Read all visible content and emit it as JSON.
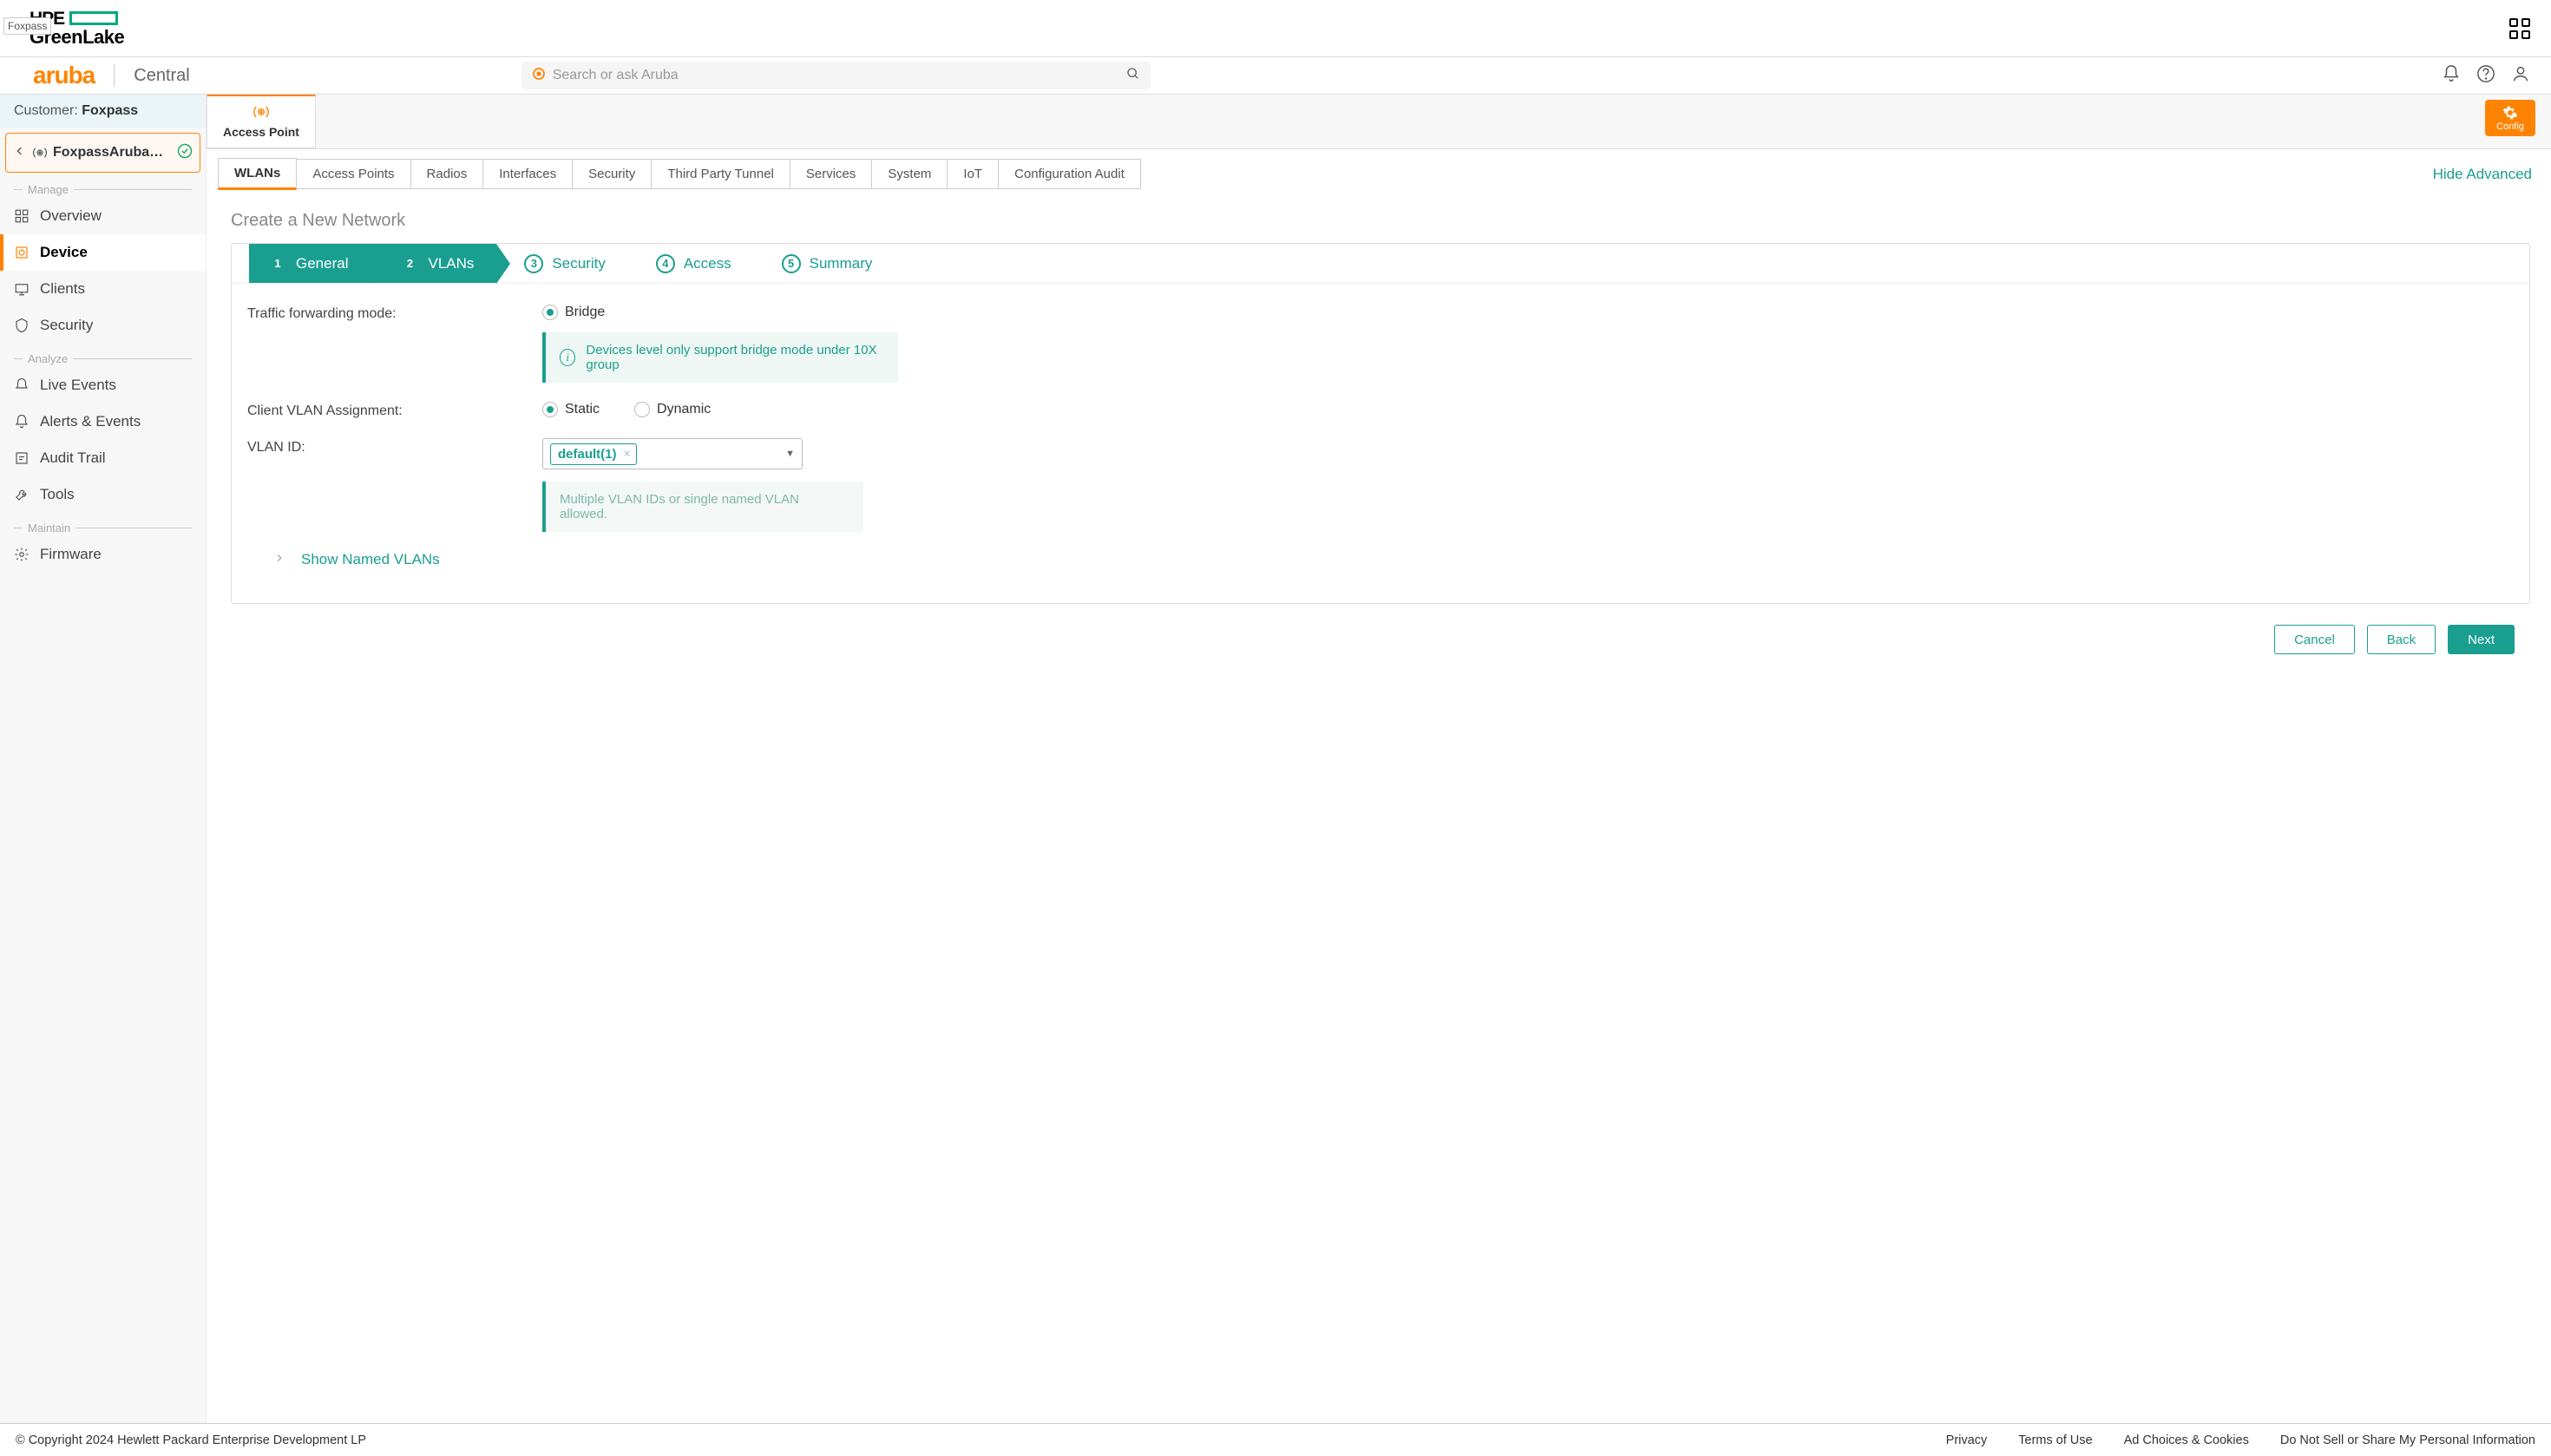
{
  "top": {
    "tag": "Foxpass",
    "hpe": "HPE",
    "greenlake": "GreenLake"
  },
  "aruba": {
    "brand": "aruba",
    "product": "Central",
    "search_placeholder": "Search or ask Aruba"
  },
  "customer": {
    "label": "Customer: ",
    "name": "Foxpass"
  },
  "crumb": {
    "device": "FoxpassArubaAP…"
  },
  "side": {
    "groups": {
      "manage": "Manage",
      "analyze": "Analyze",
      "maintain": "Maintain"
    },
    "items": {
      "overview": "Overview",
      "device": "Device",
      "clients": "Clients",
      "security": "Security",
      "live_events": "Live Events",
      "alerts_events": "Alerts & Events",
      "audit_trail": "Audit Trail",
      "tools": "Tools",
      "firmware": "Firmware"
    }
  },
  "contextTab": {
    "title": "Access Point",
    "config": "Config"
  },
  "tabs": [
    "WLANs",
    "Access Points",
    "Radios",
    "Interfaces",
    "Security",
    "Third Party Tunnel",
    "Services",
    "System",
    "IoT",
    "Configuration Audit"
  ],
  "hideAdvanced": "Hide Advanced",
  "page": {
    "title": "Create a New Network"
  },
  "steps": [
    "General",
    "VLANs",
    "Security",
    "Access",
    "Summary"
  ],
  "form": {
    "traffic_label": "Traffic forwarding mode:",
    "bridge": "Bridge",
    "info1": "Devices level only support bridge mode under 10X group",
    "cva_label": "Client VLAN Assignment:",
    "static": "Static",
    "dynamic": "Dynamic",
    "vlanid_label": "VLAN ID:",
    "vlan_chip": "default(1)",
    "info2": "Multiple VLAN IDs or single named VLAN allowed.",
    "show_named": "Show Named VLANs"
  },
  "buttons": {
    "cancel": "Cancel",
    "back": "Back",
    "next": "Next"
  },
  "footer": {
    "copyright": "© Copyright 2024 Hewlett Packard Enterprise Development LP",
    "links": [
      "Privacy",
      "Terms of Use",
      "Ad Choices & Cookies",
      "Do Not Sell or Share My Personal Information"
    ]
  }
}
